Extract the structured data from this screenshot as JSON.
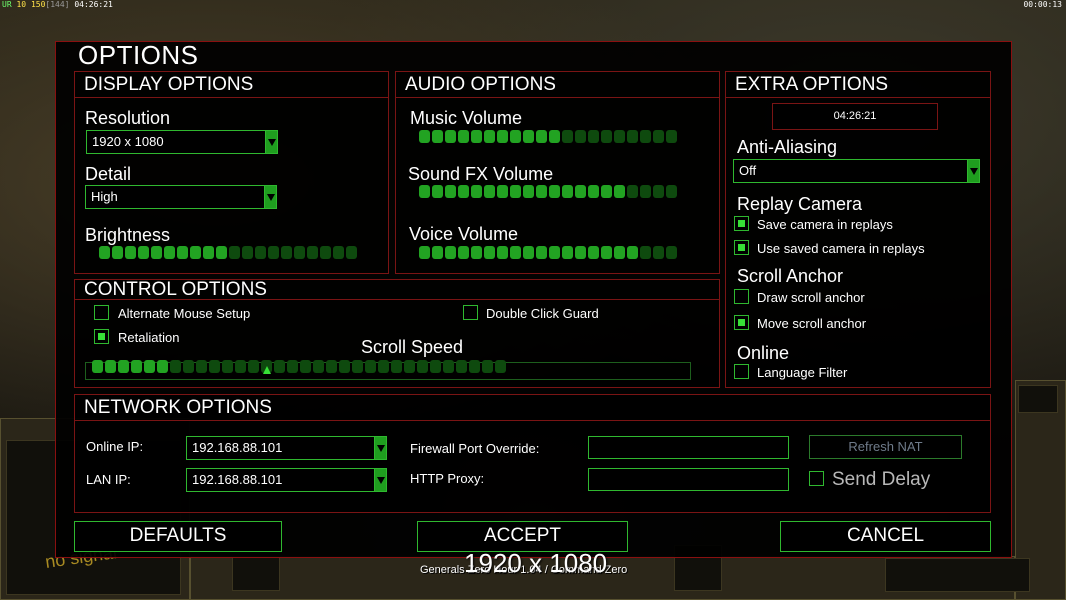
{
  "hud": {
    "top_left": {
      "a": "UR",
      "b": "10",
      "c": "150",
      "d": "[144]",
      "time": "04:26:21"
    },
    "top_right": "00:00:13",
    "bottom_left_text": "no signal"
  },
  "dialog": {
    "title": "OPTIONS",
    "display": {
      "heading": "DISPLAY OPTIONS",
      "resolution_label": "Resolution",
      "resolution_value": "1920 x 1080",
      "detail_label": "Detail",
      "detail_value": "High",
      "brightness_label": "Brightness",
      "brightness_level": 0.48
    },
    "audio": {
      "heading": "AUDIO OPTIONS",
      "music_label": "Music Volume",
      "music_level": 0.55,
      "sfx_label": "Sound FX Volume",
      "sfx_level": 0.78,
      "voice_label": "Voice Volume",
      "voice_level": 0.85
    },
    "extra": {
      "heading": "EXTRA OPTIONS",
      "clock": "04:26:21",
      "aa_label": "Anti-Aliasing",
      "aa_value": "Off",
      "replay_label": "Replay Camera",
      "save_camera": "Save camera in replays",
      "use_saved_camera": "Use saved camera in replays",
      "scroll_anchor_label": "Scroll Anchor",
      "draw_anchor": "Draw scroll anchor",
      "move_anchor": "Move scroll anchor",
      "online_label": "Online",
      "language_filter": "Language Filter"
    },
    "control": {
      "heading": "CONTROL OPTIONS",
      "alt_mouse": "Alternate Mouse Setup",
      "retaliation": "Retaliation",
      "double_click": "Double Click Guard",
      "scroll_speed_label": "Scroll Speed",
      "scroll_speed_level": 0.19
    },
    "network": {
      "heading": "NETWORK OPTIONS",
      "online_ip_label": "Online IP:",
      "online_ip_value": "192.168.88.101",
      "lan_ip_label": "LAN IP:",
      "lan_ip_value": "192.168.88.101",
      "firewall_label": "Firewall Port Override:",
      "http_proxy_label": "HTTP Proxy:",
      "refresh_nat": "Refresh NAT",
      "send_delay": "Send Delay"
    },
    "buttons": {
      "defaults": "DEFAULTS",
      "accept": "ACCEPT",
      "cancel": "CANCEL"
    }
  },
  "footer": {
    "version": "Generals Zero Hour 1.04 / Command Zero",
    "resolution_overlay": "1920 x 1080"
  },
  "colors": {
    "accent_green": "#2fb82f",
    "border_red": "#7a1414",
    "segment_on": "#22a322",
    "segment_off": "#0e4a0e"
  }
}
